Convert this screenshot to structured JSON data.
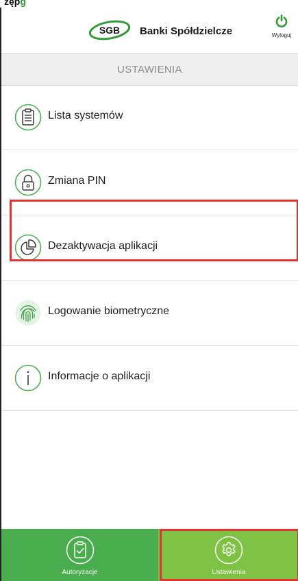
{
  "caption": {
    "text": "zęp",
    "accent_text": "g"
  },
  "header": {
    "logo_badge": "SGB",
    "brand_name": "Banki Spółdzielcze",
    "logout_label": "Wyloguj",
    "logout_icon": "power-icon"
  },
  "section_title": "USTAWIENIA",
  "menu": {
    "items": [
      {
        "label": "Lista systemów",
        "icon": "clipboard-list-icon"
      },
      {
        "label": "Zmiana PIN",
        "icon": "lock-icon"
      },
      {
        "label": "Dezaktywacja aplikacji",
        "icon": "pie-chart-icon"
      },
      {
        "label": "Logowanie biometryczne",
        "icon": "fingerprint-icon"
      },
      {
        "label": "Informacje o aplikacji",
        "icon": "info-icon"
      }
    ]
  },
  "tabs": [
    {
      "label": "Autoryzacje",
      "icon": "clipboard-check-icon",
      "active": false
    },
    {
      "label": "Ustawienia",
      "icon": "gear-icon",
      "active": true
    }
  ],
  "colors": {
    "green_primary": "#4caf50",
    "green_active": "#7dc242",
    "highlight_red": "#e53036",
    "section_bg": "#efefef"
  }
}
